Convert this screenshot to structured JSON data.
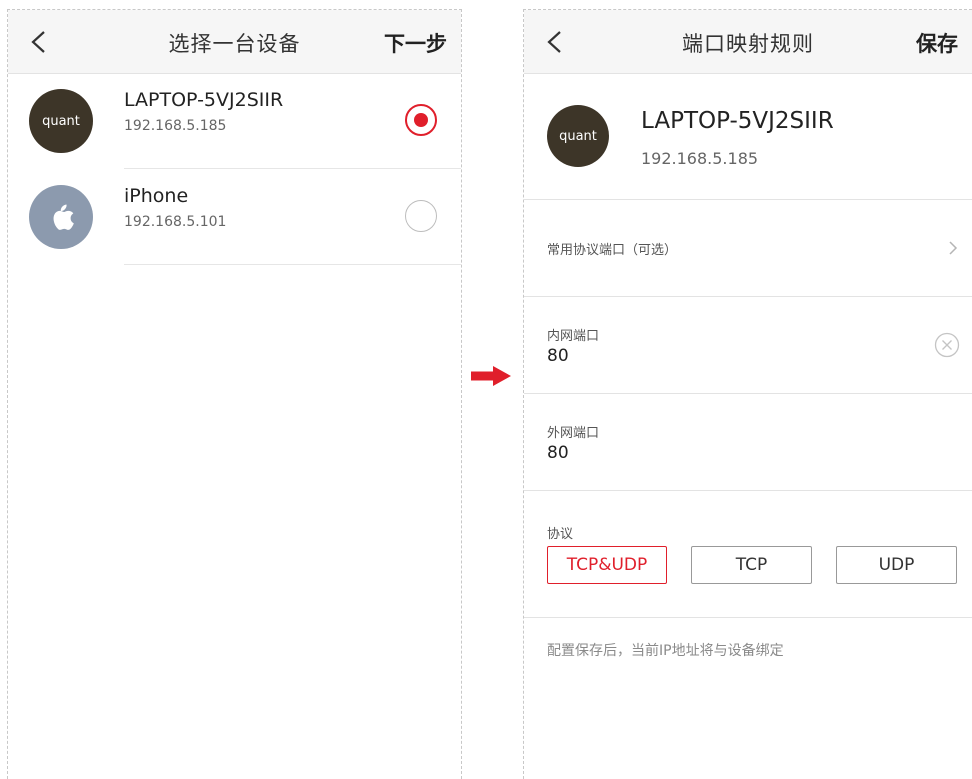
{
  "left": {
    "title": "选择一台设备",
    "next_label": "下一步",
    "devices": [
      {
        "avatar_text": "quant",
        "name": "LAPTOP-5VJ2SIIR",
        "ip": "192.168.5.185",
        "selected": true
      },
      {
        "avatar_icon": "apple-icon",
        "name": "iPhone",
        "ip": "192.168.5.101",
        "selected": false
      }
    ]
  },
  "right": {
    "title": "端口映射规则",
    "save_label": "保存",
    "device": {
      "avatar_text": "quant",
      "name": "LAPTOP-5VJ2SIIR",
      "ip": "192.168.5.185"
    },
    "common_ports_label": "常用协议端口（可选）",
    "internal_port": {
      "label": "内网端口",
      "value": "80"
    },
    "external_port": {
      "label": "外网端口",
      "value": "80"
    },
    "protocol": {
      "label": "协议",
      "options": [
        "TCP&UDP",
        "TCP",
        "UDP"
      ],
      "selected": "TCP&UDP"
    },
    "note": "配置保存后，当前IP地址将与设备绑定"
  },
  "colors": {
    "accent": "#e01f2b",
    "header_bg": "#f6f6f6",
    "avatar_dark": "#3d3528",
    "apple_avatar": "#8c9aae"
  }
}
